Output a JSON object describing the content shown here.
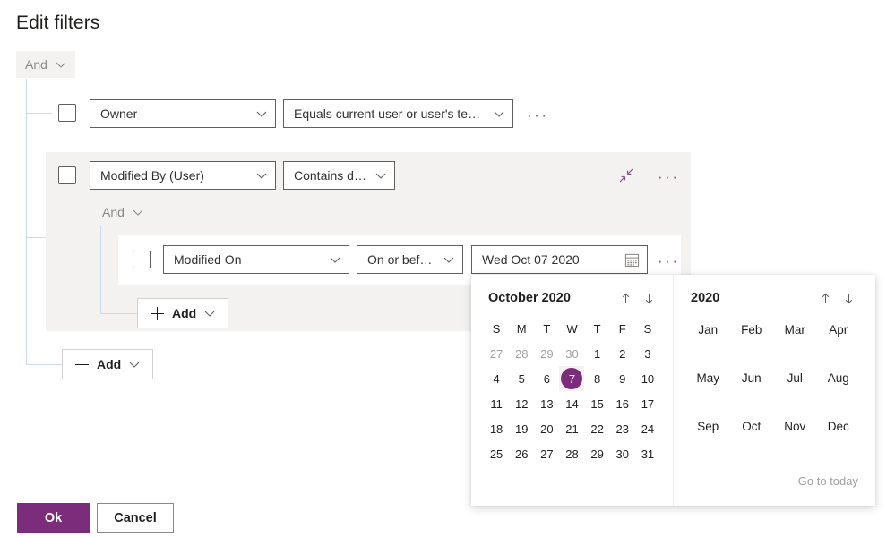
{
  "page": {
    "title": "Edit filters"
  },
  "root_operator": {
    "label": "And",
    "icon": "chevron-down-icon"
  },
  "rows": {
    "owner": {
      "field": "Owner",
      "operator": "Equals current user or user's teams",
      "more": "···"
    },
    "modified_by": {
      "field": "Modified By (User)",
      "operator": "Contains data",
      "collapse_icon": "collapse-arrows-icon",
      "more": "···"
    },
    "group_operator": {
      "label": "And",
      "icon": "chevron-down-icon"
    },
    "modified_on": {
      "field": "Modified On",
      "operator": "On or before",
      "value": "Wed Oct 07 2020",
      "calendar_icon": "calendar-icon",
      "more": "···"
    }
  },
  "add_buttons": {
    "inner": "Add",
    "outer": "Add"
  },
  "footer": {
    "ok": "Ok",
    "cancel": "Cancel"
  },
  "calendar": {
    "month_title": "October 2020",
    "prev_icon": "arrow-up-icon",
    "next_icon": "arrow-down-icon",
    "weekdays": [
      "S",
      "M",
      "T",
      "W",
      "T",
      "F",
      "S"
    ],
    "weeks": [
      [
        {
          "d": "27",
          "out": true
        },
        {
          "d": "28",
          "out": true
        },
        {
          "d": "29",
          "out": true
        },
        {
          "d": "30",
          "out": true
        },
        {
          "d": "1",
          "out": false
        },
        {
          "d": "2",
          "out": false
        },
        {
          "d": "3",
          "out": false
        }
      ],
      [
        {
          "d": "4",
          "out": false
        },
        {
          "d": "5",
          "out": false
        },
        {
          "d": "6",
          "out": false
        },
        {
          "d": "7",
          "out": false,
          "sel": true
        },
        {
          "d": "8",
          "out": false
        },
        {
          "d": "9",
          "out": false
        },
        {
          "d": "10",
          "out": false
        }
      ],
      [
        {
          "d": "11",
          "out": false
        },
        {
          "d": "12",
          "out": false
        },
        {
          "d": "13",
          "out": false
        },
        {
          "d": "14",
          "out": false
        },
        {
          "d": "15",
          "out": false
        },
        {
          "d": "16",
          "out": false
        },
        {
          "d": "17",
          "out": false
        }
      ],
      [
        {
          "d": "18",
          "out": false
        },
        {
          "d": "19",
          "out": false
        },
        {
          "d": "20",
          "out": false
        },
        {
          "d": "21",
          "out": false
        },
        {
          "d": "22",
          "out": false
        },
        {
          "d": "23",
          "out": false
        },
        {
          "d": "24",
          "out": false
        }
      ],
      [
        {
          "d": "25",
          "out": false
        },
        {
          "d": "26",
          "out": false
        },
        {
          "d": "27",
          "out": false
        },
        {
          "d": "28",
          "out": false
        },
        {
          "d": "29",
          "out": false
        },
        {
          "d": "30",
          "out": false
        },
        {
          "d": "31",
          "out": false
        }
      ]
    ],
    "selected_day": "7"
  },
  "year_picker": {
    "year_title": "2020",
    "prev_icon": "arrow-up-icon",
    "next_icon": "arrow-down-icon",
    "months": [
      "Jan",
      "Feb",
      "Mar",
      "Apr",
      "May",
      "Jun",
      "Jul",
      "Aug",
      "Sep",
      "Oct",
      "Nov",
      "Dec"
    ],
    "go_to_today": "Go to today"
  },
  "colors": {
    "accent": "#7b2c7b",
    "tree_line": "#c8d9f0",
    "group_bg": "#f3f2f1",
    "border": "#605e5c"
  }
}
